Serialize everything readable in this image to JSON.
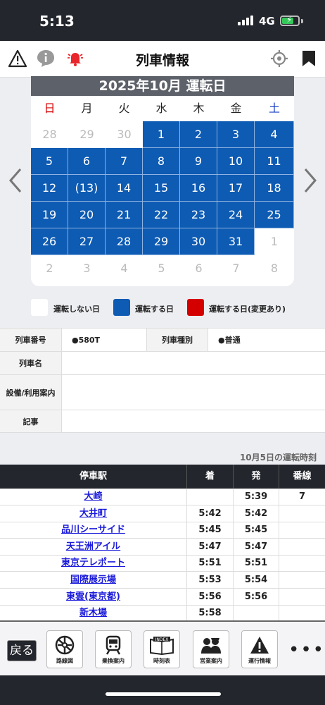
{
  "status": {
    "time": "5:13",
    "network": "4G"
  },
  "header": {
    "title": "列車情報"
  },
  "calendar": {
    "title": "2025年10月 運転日",
    "weekdays": [
      "日",
      "月",
      "火",
      "水",
      "木",
      "金",
      "土"
    ],
    "weeks": [
      [
        {
          "d": "28",
          "s": "off"
        },
        {
          "d": "29",
          "s": "off"
        },
        {
          "d": "30",
          "s": "off"
        },
        {
          "d": "1",
          "s": "run"
        },
        {
          "d": "2",
          "s": "run"
        },
        {
          "d": "3",
          "s": "run"
        },
        {
          "d": "4",
          "s": "run"
        }
      ],
      [
        {
          "d": "5",
          "s": "run"
        },
        {
          "d": "6",
          "s": "run"
        },
        {
          "d": "7",
          "s": "run"
        },
        {
          "d": "8",
          "s": "run"
        },
        {
          "d": "9",
          "s": "run"
        },
        {
          "d": "10",
          "s": "run"
        },
        {
          "d": "11",
          "s": "run"
        }
      ],
      [
        {
          "d": "12",
          "s": "run"
        },
        {
          "d": "(13)",
          "s": "run"
        },
        {
          "d": "14",
          "s": "run"
        },
        {
          "d": "15",
          "s": "run"
        },
        {
          "d": "16",
          "s": "run"
        },
        {
          "d": "17",
          "s": "run"
        },
        {
          "d": "18",
          "s": "run"
        }
      ],
      [
        {
          "d": "19",
          "s": "run"
        },
        {
          "d": "20",
          "s": "run"
        },
        {
          "d": "21",
          "s": "run"
        },
        {
          "d": "22",
          "s": "run"
        },
        {
          "d": "23",
          "s": "run"
        },
        {
          "d": "24",
          "s": "run"
        },
        {
          "d": "25",
          "s": "run"
        }
      ],
      [
        {
          "d": "26",
          "s": "run"
        },
        {
          "d": "27",
          "s": "run"
        },
        {
          "d": "28",
          "s": "run"
        },
        {
          "d": "29",
          "s": "run"
        },
        {
          "d": "30",
          "s": "run"
        },
        {
          "d": "31",
          "s": "run"
        },
        {
          "d": "1",
          "s": "off"
        }
      ],
      [
        {
          "d": "2",
          "s": "off"
        },
        {
          "d": "3",
          "s": "off"
        },
        {
          "d": "4",
          "s": "off"
        },
        {
          "d": "5",
          "s": "off"
        },
        {
          "d": "6",
          "s": "off"
        },
        {
          "d": "7",
          "s": "off"
        },
        {
          "d": "8",
          "s": "off"
        }
      ]
    ]
  },
  "legend": {
    "not_running": "運転しない日",
    "running": "運転する日",
    "running_changed": "運転する日(変更あり)"
  },
  "colors": {
    "run": "#0e5bb3",
    "changed": "#d40000",
    "header_dark": "#23262c"
  },
  "info": {
    "train_number_label": "列車番号",
    "train_number": "●580T",
    "train_type_label": "列車種別",
    "train_type": "●普通",
    "train_name_label": "列車名",
    "train_name": "",
    "facilities_label": "設備/利用案内",
    "facilities": "",
    "notes_label": "記事",
    "notes": ""
  },
  "timetable": {
    "date_label": "10月5日の運転時刻",
    "headers": {
      "station": "停車駅",
      "arrive": "着",
      "depart": "発",
      "track": "番線"
    },
    "rows": [
      {
        "station": "大崎",
        "arrive": "",
        "depart": "5:39",
        "track": "7"
      },
      {
        "station": "大井町",
        "arrive": "5:42",
        "depart": "5:42",
        "track": ""
      },
      {
        "station": "品川シーサイド",
        "arrive": "5:45",
        "depart": "5:45",
        "track": ""
      },
      {
        "station": "天王洲アイル",
        "arrive": "5:47",
        "depart": "5:47",
        "track": ""
      },
      {
        "station": "東京テレポート",
        "arrive": "5:51",
        "depart": "5:51",
        "track": ""
      },
      {
        "station": "国際展示場",
        "arrive": "5:53",
        "depart": "5:54",
        "track": ""
      },
      {
        "station": "東雲(東京都)",
        "arrive": "5:56",
        "depart": "5:56",
        "track": ""
      },
      {
        "station": "新木場",
        "arrive": "5:58",
        "depart": "",
        "track": ""
      }
    ]
  },
  "bottom": {
    "back": "戻る",
    "items": [
      "路線図",
      "乗換案内",
      "時刻表",
      "営業案内",
      "運行情報"
    ],
    "index_text": "INDEX",
    "more": "•••"
  }
}
